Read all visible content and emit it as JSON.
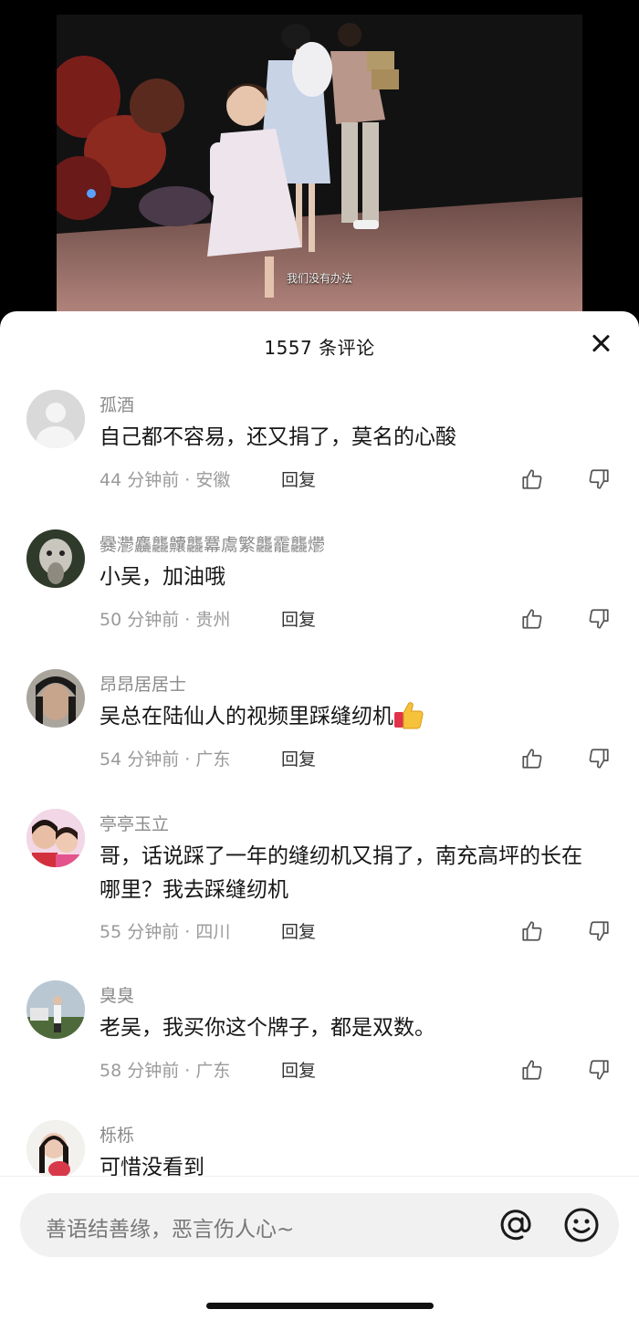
{
  "video": {
    "subtitle": "我们没有办法"
  },
  "sheet": {
    "title": "1557 条评论"
  },
  "comments": [
    {
      "name": "孤酒",
      "text": "自己都不容易，还又捐了，莫名的心酸",
      "meta": "44 分钟前 · 安徽",
      "reply": "回复"
    },
    {
      "name": "爨灪麤龘齉龘羃鬳繁龘靇龘爩",
      "text": "小吴，加油哦",
      "meta": "50 分钟前 · 贵州",
      "reply": "回复"
    },
    {
      "name": "昂昂居居士",
      "text": "吴总在陆仙人的视频里踩缝纫机",
      "emoji": "thumbs-up-emoji",
      "meta": "54 分钟前 · 广东",
      "reply": "回复"
    },
    {
      "name": "亭亭玉立",
      "text": "哥，话说踩了一年的缝纫机又捐了，南充高坪的长在哪里？我去踩缝纫机",
      "meta": "55 分钟前 · 四川",
      "reply": "回复"
    },
    {
      "name": "臭臭",
      "text": "老吴，我买你这个牌子，都是双数。",
      "meta": "58 分钟前 · 广东",
      "reply": "回复"
    },
    {
      "name": "栎栎",
      "text": "可惜没看到"
    }
  ],
  "input": {
    "placeholder": "善语结善缘，恶言伤人心~"
  },
  "icons": {
    "close": "close-icon",
    "like": "thumbs-up-icon",
    "dislike": "thumbs-down-icon",
    "at": "at-icon",
    "emoji": "smile-icon"
  }
}
